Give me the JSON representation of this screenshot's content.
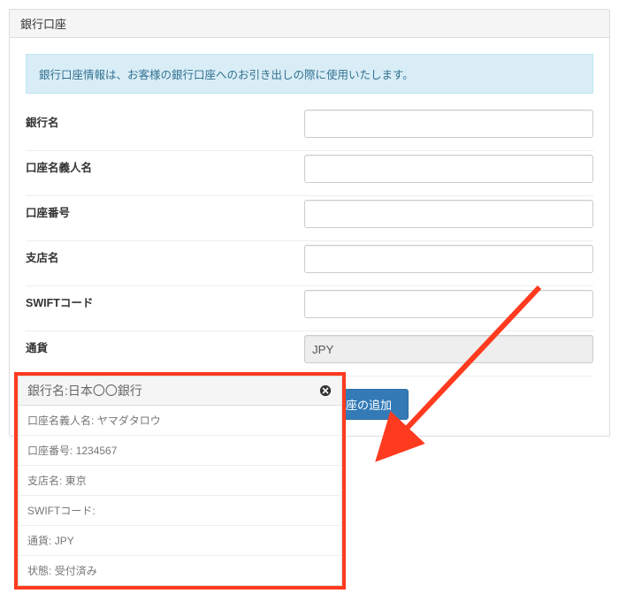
{
  "panel": {
    "title": "銀行口座"
  },
  "alert": "銀行口座情報は、お客様の銀行口座へのお引き出しの際に使用いたします。",
  "form": {
    "bank_label": "銀行名",
    "holder_label": "口座名義人名",
    "account_no_label": "口座番号",
    "branch_label": "支店名",
    "swift_label": "SWIFTコード",
    "currency_label": "通貨",
    "currency_value": "JPY",
    "submit_label": "口座の追加"
  },
  "card": {
    "heading_label": "銀行名",
    "bank_name": "日本〇〇銀行",
    "rows": [
      {
        "label": "口座名義人名",
        "value": "ヤマダタロウ"
      },
      {
        "label": "口座番号",
        "value": "1234567"
      },
      {
        "label": "支店名",
        "value": "東京"
      },
      {
        "label": "SWIFTコード",
        "value": ""
      },
      {
        "label": "通貨",
        "value": "JPY"
      },
      {
        "label": "状態",
        "value": "受付済み"
      }
    ]
  }
}
